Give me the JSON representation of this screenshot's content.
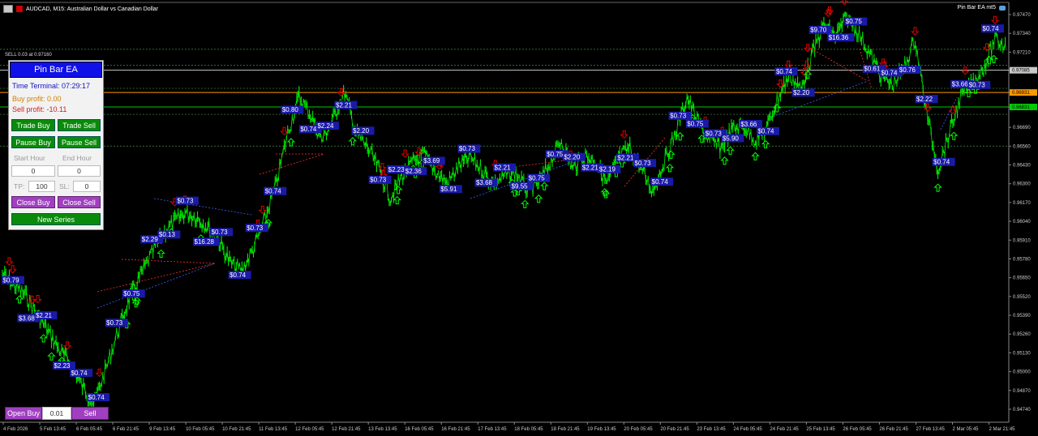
{
  "window": {
    "title": "AUDCAD, M15:  Australian Dollar vs Canadian Dollar",
    "ea_label": "Pin Bar EA mt5",
    "sell_order_label": "SELL 0.03 at 0.97160"
  },
  "panel": {
    "title": "Pin Bar EA",
    "time_terminal": "Time Terminal: 07:29:17",
    "buy_profit": "Buy profit: 0.00",
    "sell_profit": "Sell profit: -10.11",
    "trade_buy": "Trade Buy",
    "trade_sell": "Trade Sell",
    "pause_buy": "Pause Buy",
    "pause_sell": "Pause Sell",
    "start_hour_label": "Start Hour",
    "end_hour_label": "End Hour",
    "start_hour_value": "0",
    "end_hour_value": "0",
    "tp_label": "TP:",
    "tp_value": "100",
    "sl_label": "SL:",
    "sl_value": "0",
    "close_buy": "Close Buy",
    "close_sell": "Close Sell",
    "new_series": "New Series"
  },
  "bottom": {
    "open_buy": "Open Buy",
    "lot_value": "0.01",
    "open_sell": "Sell"
  },
  "colors": {
    "candles": "#00e600",
    "buy_arrow": "#00ff00",
    "sell_arrow": "#e00000",
    "profit_label_bg": "#1a1aa8",
    "sell_line": "#ff8c00",
    "green_line": "#00cc00",
    "panel_title_bg": "#1010e8"
  },
  "chart_data": {
    "type": "line",
    "symbol": "AUDCAD",
    "timeframe": "M15",
    "y_ticks": [
      "0.97470",
      "0.97340",
      "0.97210",
      "0.97085",
      "0.96931",
      "0.96831",
      "0.96690",
      "0.96560",
      "0.96430",
      "0.96300",
      "0.96170",
      "0.96040",
      "0.95910",
      "0.95780",
      "0.95650",
      "0.95520",
      "0.95390",
      "0.95260",
      "0.95130",
      "0.95000",
      "0.94870",
      "0.94740"
    ],
    "highlighted_prices": [
      {
        "value": "0.96931",
        "color": "#ff9900"
      },
      {
        "value": "0.96831",
        "color": "#00cc00"
      },
      {
        "value": "0.97085",
        "color": "#c8c8c8"
      }
    ],
    "x_ticks": [
      "4 Feb 2026",
      "5 Feb 13:45",
      "6 Feb 05:45",
      "6 Feb 21:45",
      "9 Feb 13:45",
      "10 Feb 05:45",
      "10 Feb 21:45",
      "11 Feb 13:45",
      "12 Feb 05:45",
      "12 Feb 21:45",
      "13 Feb 13:45",
      "16 Feb 05:45",
      "16 Feb 21:45",
      "17 Feb 13:45",
      "18 Feb 05:45",
      "18 Feb 21:45",
      "19 Feb 13:45",
      "20 Feb 05:45",
      "20 Feb 21:45",
      "23 Feb 13:45",
      "24 Feb 05:45",
      "24 Feb 21:45",
      "25 Feb 13:45",
      "26 Feb 05:45",
      "26 Feb 21:45",
      "27 Feb 13:45",
      "2 Mar 05:45",
      "2 Mar 21:45"
    ],
    "price_path": [
      0.9567,
      0.956,
      0.9553,
      0.954,
      0.9528,
      0.9515,
      0.9505,
      0.949,
      0.9478,
      0.95,
      0.9525,
      0.9548,
      0.9565,
      0.958,
      0.9595,
      0.9603,
      0.961,
      0.9607,
      0.96,
      0.959,
      0.9575,
      0.957,
      0.9585,
      0.9605,
      0.963,
      0.9665,
      0.969,
      0.9678,
      0.966,
      0.9675,
      0.9693,
      0.9665,
      0.9655,
      0.964,
      0.962,
      0.9635,
      0.9645,
      0.965,
      0.9638,
      0.963,
      0.9642,
      0.9648,
      0.964,
      0.963,
      0.9635,
      0.9638,
      0.9625,
      0.963,
      0.9645,
      0.966,
      0.964,
      0.965,
      0.9645,
      0.963,
      0.9648,
      0.9655,
      0.964,
      0.9625,
      0.9645,
      0.9665,
      0.969,
      0.9672,
      0.966,
      0.9655,
      0.9668,
      0.967,
      0.966,
      0.9668,
      0.969,
      0.9705,
      0.9695,
      0.972,
      0.974,
      0.9732,
      0.9745,
      0.9735,
      0.972,
      0.9705,
      0.9698,
      0.971,
      0.973,
      0.968,
      0.964,
      0.9665,
      0.969,
      0.97,
      0.971,
      0.973,
      0.9725
    ],
    "profit_labels": [
      "$0.79",
      "$3.68",
      "$2.21",
      "$2.23",
      "$0.74",
      "$0.74",
      "$0.73",
      "$0.75",
      "$2.29",
      "$0.13",
      "$0.73",
      "$16.28",
      "$0.73",
      "$0.74",
      "$0.73",
      "$0.74",
      "$0.80",
      "$0.74",
      "$2.24",
      "$2.21",
      "$2.20",
      "$0.73",
      "$2.23",
      "$2.36",
      "$3.69",
      "$5.91",
      "$0.73",
      "$3.68",
      "$2.21",
      "$9.55",
      "$0.75",
      "$0.75",
      "$2.20",
      "$2.21",
      "$2.19",
      "$2.21",
      "$0.73",
      "$0.74",
      "$0.73",
      "$0.75",
      "$0.73",
      "$5.90",
      "$3.66",
      "$0.74",
      "$0.74",
      "$2.20",
      "$9.70",
      "$16.36",
      "$0.75",
      "$0.61",
      "$0.74",
      "$0.76",
      "$2.22",
      "$0.74",
      "$3.66",
      "$0.73",
      "$0.74"
    ]
  }
}
